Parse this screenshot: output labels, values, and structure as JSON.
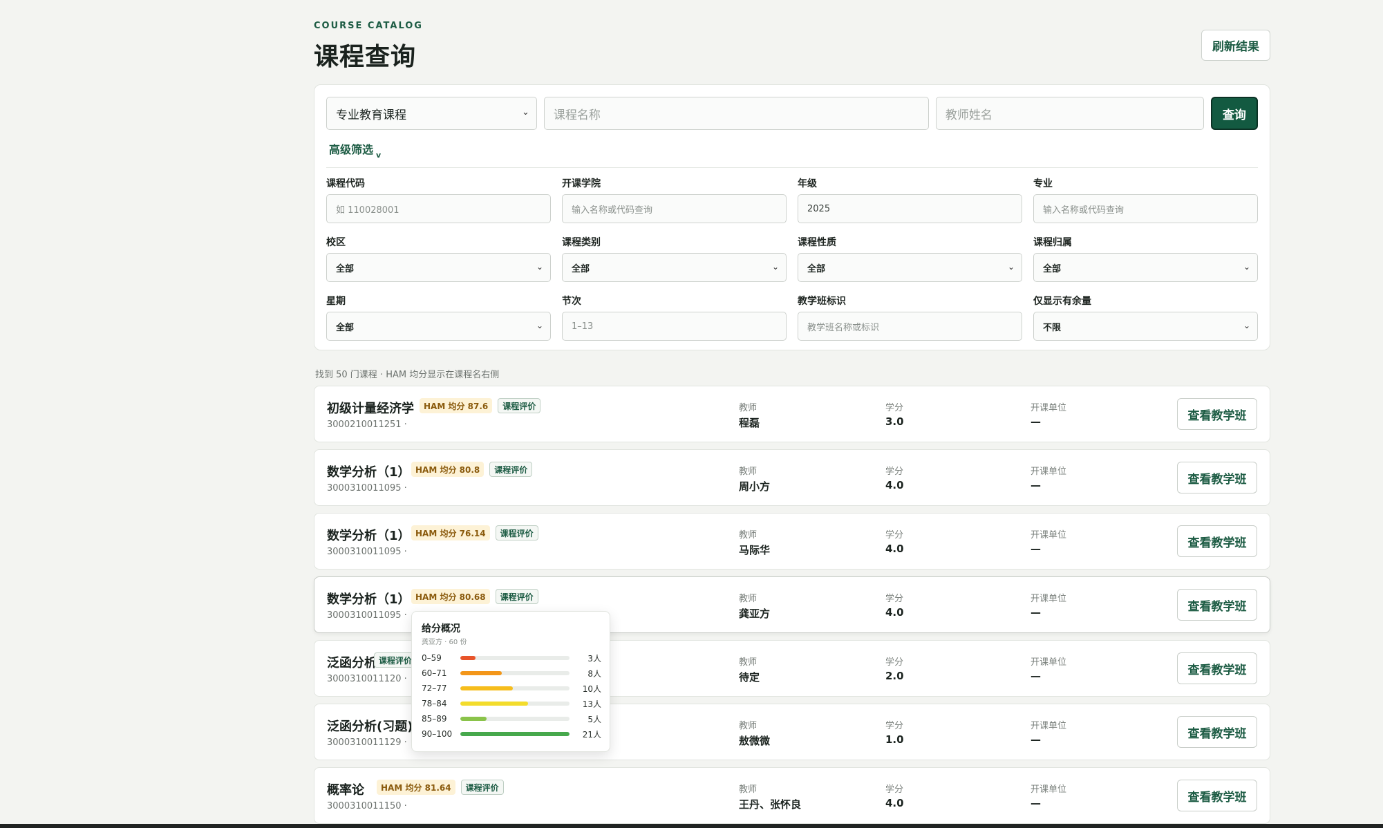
{
  "header": {
    "eyebrow": "COURSE CATALOG",
    "title": "课程查询",
    "refresh_label": "刷新结果"
  },
  "search": {
    "category_value": "专业教育课程",
    "course_name_placeholder": "课程名称",
    "teacher_placeholder": "教师姓名",
    "query_label": "查询",
    "advanced_label": "高级筛选"
  },
  "advanced": {
    "course_code": {
      "label": "课程代码",
      "placeholder": "如 110028001"
    },
    "college": {
      "label": "开课学院",
      "placeholder": "输入名称或代码查询"
    },
    "grade": {
      "label": "年级",
      "value": "2025"
    },
    "major": {
      "label": "专业",
      "placeholder": "输入名称或代码查询"
    },
    "campus": {
      "label": "校区",
      "value": "全部"
    },
    "course_type": {
      "label": "课程类别",
      "value": "全部"
    },
    "course_nature": {
      "label": "课程性质",
      "value": "全部"
    },
    "course_owner": {
      "label": "课程归属",
      "value": "全部"
    },
    "weekday": {
      "label": "星期",
      "value": "全部"
    },
    "period": {
      "label": "节次",
      "placeholder": "1–13"
    },
    "class_tag": {
      "label": "教学班标识",
      "placeholder": "教学班名称或标识"
    },
    "only_available": {
      "label": "仅显示有余量",
      "value": "不限"
    }
  },
  "results": {
    "summary": "找到 50 门课程 · HAM 均分显示在课程名右侧",
    "column_labels": {
      "teacher": "教师",
      "credit": "学分",
      "dept": "开课单位"
    },
    "view_label": "查看教学班",
    "eval_label": "课程评价",
    "courses": [
      {
        "name": "初级计量经济学",
        "ham": "HAM 均分 87.6",
        "code": "3000210011251 ·",
        "teacher": "程磊",
        "credit": "3.0",
        "dept": "—"
      },
      {
        "name": "数学分析（1）",
        "ham": "HAM 均分 80.8",
        "code": "3000310011095 ·",
        "teacher": "周小方",
        "credit": "4.0",
        "dept": "—"
      },
      {
        "name": "数学分析（1）",
        "ham": "HAM 均分 76.14",
        "code": "3000310011095 ·",
        "teacher": "马际华",
        "credit": "4.0",
        "dept": "—"
      },
      {
        "name": "数学分析（1）",
        "ham": "HAM 均分 80.68",
        "code": "3000310011095 ·",
        "teacher": "龚亚方",
        "credit": "4.0",
        "dept": "—"
      },
      {
        "name": "泛函分析",
        "ham": "",
        "code": "3000310011120 ·",
        "teacher": "待定",
        "credit": "2.0",
        "dept": "—"
      },
      {
        "name": "泛函分析(习题)",
        "ham": "",
        "code": "3000310011129 ·",
        "teacher": "敖微微",
        "credit": "1.0",
        "dept": "—"
      },
      {
        "name": "概率论",
        "ham": "HAM 均分 81.64",
        "code": "3000310011150 ·",
        "teacher": "王丹、张怀良",
        "credit": "4.0",
        "dept": "—"
      }
    ]
  },
  "popover": {
    "title": "给分概况",
    "subtitle": "龚亚方 · 60 份",
    "buckets": [
      {
        "range": "0–59",
        "count": "3人",
        "fraction": 0.14,
        "color": "#e8542a"
      },
      {
        "range": "60–71",
        "count": "8人",
        "fraction": 0.38,
        "color": "#f39619"
      },
      {
        "range": "72–77",
        "count": "10人",
        "fraction": 0.48,
        "color": "#f6bd1c"
      },
      {
        "range": "78–84",
        "count": "13人",
        "fraction": 0.62,
        "color": "#f3dc2c"
      },
      {
        "range": "85–89",
        "count": "5人",
        "fraction": 0.24,
        "color": "#8ac34a"
      },
      {
        "range": "90–100",
        "count": "21人",
        "fraction": 1.0,
        "color": "#46a84c"
      }
    ]
  }
}
